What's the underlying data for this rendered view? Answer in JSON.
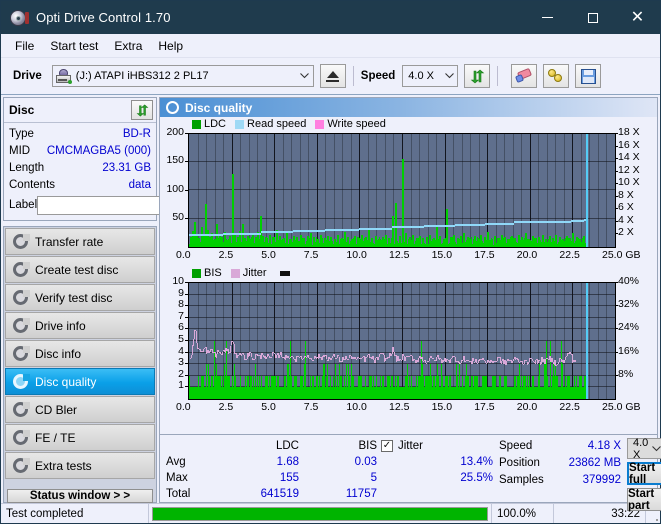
{
  "window": {
    "title": "Opti Drive Control 1.70",
    "icon": "disc-icon",
    "minimize_label": "–",
    "maximize_label": "□",
    "close_label": "✕"
  },
  "menu": {
    "items": [
      {
        "label": "File"
      },
      {
        "label": "Start test"
      },
      {
        "label": "Extra"
      },
      {
        "label": "Help"
      }
    ]
  },
  "toolbar": {
    "drive_label": "Drive",
    "drive_value": "(J:)  ATAPI iHBS312  2 PL17",
    "eject_icon": "eject-icon",
    "speed_label": "Speed",
    "speed_value": "4.0 X",
    "refresh_icon": "refresh-icon",
    "erase_icon": "eraser-icon",
    "bulb_icon": "bulbs-icon",
    "save_icon": "save-icon"
  },
  "disc_panel": {
    "title": "Disc",
    "refresh_icon": "refresh-icon",
    "rows": [
      {
        "key": "Type",
        "value": "BD-R"
      },
      {
        "key": "MID",
        "value": "CMCMAGBA5 (000)"
      },
      {
        "key": "Length",
        "value": "23.31 GB"
      },
      {
        "key": "Contents",
        "value": "data"
      }
    ],
    "label_key": "Label",
    "label_value": "",
    "label_placeholder": "",
    "disc_icon": "disc-icon"
  },
  "sidebar": {
    "items": [
      {
        "label": "Transfer rate",
        "icon": "disc-test-icon",
        "active": false
      },
      {
        "label": "Create test disc",
        "icon": "disc-test-icon",
        "active": false
      },
      {
        "label": "Verify test disc",
        "icon": "disc-test-icon",
        "active": false
      },
      {
        "label": "Drive info",
        "icon": "disc-test-icon",
        "active": false
      },
      {
        "label": "Disc info",
        "icon": "disc-test-icon",
        "active": false
      },
      {
        "label": "Disc quality",
        "icon": "disc-test-icon",
        "active": true
      },
      {
        "label": "CD Bler",
        "icon": "disc-test-icon",
        "active": false
      },
      {
        "label": "FE / TE",
        "icon": "disc-test-icon",
        "active": false
      },
      {
        "label": "Extra tests",
        "icon": "disc-test-icon",
        "active": false
      }
    ],
    "status_window_label": "Status window > >"
  },
  "panel": {
    "title": "Disc quality",
    "icon": "disc-quality-icon"
  },
  "stats": {
    "col_headers": [
      "LDC",
      "BIS"
    ],
    "rows": [
      {
        "key": "Avg",
        "ldc": "1.68",
        "bis": "0.03",
        "jitter": "13.4%"
      },
      {
        "key": "Max",
        "ldc": "155",
        "bis": "5",
        "jitter": "25.5%"
      },
      {
        "key": "Total",
        "ldc": "641519",
        "bis": "11757",
        "jitter": ""
      }
    ],
    "jitter_label": "Jitter",
    "jitter_checked": true,
    "speed_label": "Speed",
    "speed_value": "4.18 X",
    "position_label": "Position",
    "position_value": "23862 MB",
    "samples_label": "Samples",
    "samples_value": "379992",
    "speed_select": "4.0 X",
    "start_full_label": "Start full",
    "start_part_label": "Start part"
  },
  "statusbar": {
    "message": "Test completed",
    "progress_percent": "100.0%",
    "progress_value": 100,
    "elapsed": "33:22"
  },
  "colors": {
    "accent": "#0aa0e8",
    "ldc_green": "#00b000",
    "read_speed": "#7fd4f5",
    "write_speed": "#ff80e0",
    "jitter_pink": "#d9a8d8",
    "plot_bg": "#5f6f8d",
    "value_blue": "#0000d0",
    "titlebar": "#1f3b4d"
  },
  "chart_data": [
    {
      "type": "line",
      "id": "ldc-chart",
      "title": "LDC / Read speed",
      "legend": [
        {
          "name": "LDC",
          "color": "#00a000"
        },
        {
          "name": "Read speed",
          "color": "#7fd4f5"
        },
        {
          "name": "Write speed",
          "color": "#ff80e0"
        }
      ],
      "legend_position": "top-left",
      "xlabel": "GB",
      "xlim": [
        0,
        25
      ],
      "xticks": [
        "0.0",
        "2.5",
        "5.0",
        "7.5",
        "10.0",
        "12.5",
        "15.0",
        "17.5",
        "20.0",
        "22.5",
        "25.0"
      ],
      "ylabel": "LDC",
      "ylim": [
        0,
        200
      ],
      "yticks": [
        50,
        100,
        150,
        200
      ],
      "y2label": "X",
      "y2lim": [
        0,
        18
      ],
      "y2ticks": [
        "2 X",
        "4 X",
        "6 X",
        "8 X",
        "10 X",
        "12 X",
        "14 X",
        "16 X",
        "18 X"
      ],
      "grid": true,
      "data_end_gb": 23.31,
      "series": [
        {
          "name": "LDC",
          "type": "bar",
          "color": "#00d000",
          "x": [
            0.05,
            0.18,
            0.3,
            0.42,
            0.55,
            0.68,
            0.8,
            0.92,
            1.05,
            1.18,
            1.3,
            1.45,
            1.6,
            1.75,
            1.9,
            2.05,
            2.2,
            2.35,
            2.5,
            2.65,
            2.8,
            2.95,
            3.1,
            3.25,
            3.4,
            3.55,
            3.7,
            3.85,
            4.0,
            4.15,
            4.3,
            4.5,
            4.7,
            4.9,
            5.1,
            5.3,
            5.5,
            5.7,
            5.9,
            6.1,
            6.3,
            6.5,
            6.7,
            6.9,
            7.1,
            7.3,
            7.5,
            7.7,
            7.9,
            8.1,
            8.3,
            8.5,
            8.7,
            8.9,
            9.1,
            9.3,
            9.5,
            9.7,
            9.9,
            10.1,
            10.3,
            10.5,
            10.7,
            10.9,
            11.1,
            11.3,
            11.5,
            11.7,
            11.9,
            12.1,
            12.3,
            12.5,
            12.7,
            12.9,
            13.1,
            13.3,
            13.5,
            13.7,
            13.9,
            14.1,
            14.3,
            14.5,
            14.7,
            14.9,
            15.1,
            15.3,
            15.5,
            15.7,
            15.9,
            16.1,
            16.3,
            16.5,
            16.7,
            16.9,
            17.1,
            17.3,
            17.5,
            17.7,
            17.9,
            18.1,
            18.3,
            18.5,
            18.7,
            18.9,
            19.1,
            19.3,
            19.5,
            19.7,
            19.9,
            20.1,
            20.3,
            20.5,
            20.7,
            20.9,
            21.1,
            21.3,
            21.5,
            21.7,
            21.9,
            22.1,
            22.3,
            22.5,
            22.7,
            22.9,
            23.1,
            23.3
          ],
          "values": [
            18,
            28,
            45,
            22,
            16,
            35,
            20,
            76,
            30,
            18,
            24,
            14,
            40,
            22,
            18,
            26,
            12,
            20,
            130,
            22,
            18,
            28,
            40,
            16,
            20,
            14,
            22,
            18,
            26,
            55,
            20,
            16,
            22,
            18,
            30,
            20,
            16,
            24,
            14,
            20,
            18,
            22,
            16,
            20,
            24,
            18,
            14,
            22,
            16,
            20,
            18,
            14,
            22,
            16,
            26,
            18,
            14,
            20,
            16,
            22,
            18,
            30,
            16,
            20,
            14,
            18,
            22,
            16,
            55,
            78,
            20,
            155,
            24,
            18,
            22,
            16,
            20,
            14,
            18,
            22,
            16,
            38,
            20,
            14,
            68,
            18,
            22,
            16,
            20,
            24,
            18,
            14,
            20,
            16,
            22,
            18,
            26,
            14,
            20,
            16,
            22,
            18,
            14,
            20,
            16,
            22,
            18,
            24,
            14,
            20,
            16,
            18,
            22,
            14,
            20,
            16,
            22,
            18,
            14,
            20,
            16,
            24,
            18,
            14,
            20,
            16
          ]
        },
        {
          "name": "Read speed",
          "type": "step-line",
          "color": "#7fd4f5",
          "x": [
            0.0,
            2.0,
            4.2,
            6.1,
            8.0,
            10.0,
            11.9,
            13.8,
            15.6,
            17.4,
            19.1,
            20.8,
            22.4,
            23.2,
            23.3
          ],
          "values": [
            2.1,
            2.3,
            2.5,
            2.7,
            2.9,
            3.1,
            3.3,
            3.5,
            3.7,
            3.9,
            4.1,
            4.2,
            4.35,
            4.4,
            18.0
          ]
        }
      ]
    },
    {
      "type": "line",
      "id": "bis-chart",
      "title": "BIS / Jitter",
      "legend": [
        {
          "name": "BIS",
          "color": "#00a000"
        },
        {
          "name": "Jitter",
          "color": "#d9a8d8"
        }
      ],
      "legend_position": "top-left",
      "xlabel": "GB",
      "xlim": [
        0,
        25
      ],
      "xticks": [
        "0.0",
        "2.5",
        "5.0",
        "7.5",
        "10.0",
        "12.5",
        "15.0",
        "17.5",
        "20.0",
        "22.5",
        "25.0"
      ],
      "ylabel": "BIS",
      "ylim": [
        0,
        10
      ],
      "yticks": [
        1,
        2,
        3,
        4,
        5,
        6,
        7,
        8,
        9,
        10
      ],
      "y2label": "%",
      "y2lim": [
        0,
        40
      ],
      "y2ticks": [
        "8%",
        "16%",
        "24%",
        "32%",
        "40%"
      ],
      "grid": true,
      "data_end_gb": 23.31,
      "series": [
        {
          "name": "BIS",
          "type": "bar",
          "color": "#00d000",
          "note": "dense bars mostly at 1-2, occasional spikes to 3-5"
        },
        {
          "name": "Jitter",
          "type": "line",
          "color": "#d9a8d8",
          "x": [
            0.1,
            0.3,
            0.5,
            0.7,
            0.9,
            1.1,
            1.3,
            1.5,
            1.7,
            1.9,
            2.1,
            2.3,
            2.5,
            2.7,
            2.9,
            3.1,
            3.3,
            3.5,
            3.7,
            3.9,
            4.1,
            4.3,
            4.5,
            4.7,
            4.9,
            5.1,
            5.3,
            5.5,
            5.7,
            5.9,
            6.1,
            6.3,
            6.5,
            6.7,
            6.9,
            7.1,
            7.3,
            7.5,
            7.7,
            7.9,
            8.1,
            8.3,
            8.5,
            8.7,
            8.9,
            9.1,
            9.3,
            9.5,
            9.7,
            9.9,
            10.1,
            10.3,
            10.5,
            10.7,
            10.9,
            11.1,
            11.3,
            11.5,
            11.7,
            11.9,
            12.1,
            12.3,
            12.5,
            12.7,
            12.9,
            13.1,
            13.3,
            13.5,
            13.7,
            13.9,
            14.1,
            14.3,
            14.5,
            14.7,
            14.9,
            15.1,
            15.3,
            15.5,
            15.7,
            15.9,
            16.1,
            16.3,
            16.5,
            16.7,
            16.9,
            17.1,
            17.3,
            17.5,
            17.7,
            17.9,
            18.1,
            18.3,
            18.5,
            18.7,
            18.9,
            19.1,
            19.3,
            19.5,
            19.7,
            19.9,
            20.1,
            20.3,
            20.5,
            20.7,
            20.9,
            21.1,
            21.3,
            21.5,
            21.7,
            21.9,
            22.1,
            22.3,
            22.5,
            22.7,
            22.9,
            23.1,
            23.3
          ],
          "values": [
            3.6,
            6.1,
            4.3,
            4.0,
            4.4,
            3.9,
            4.2,
            3.8,
            4.1,
            3.9,
            4.3,
            4.0,
            5.0,
            3.7,
            4.0,
            3.8,
            3.6,
            3.9,
            3.5,
            3.8,
            3.6,
            3.9,
            3.7,
            3.5,
            3.8,
            3.6,
            3.9,
            3.7,
            3.5,
            3.8,
            3.6,
            3.4,
            3.7,
            3.5,
            3.8,
            3.6,
            3.4,
            3.7,
            3.5,
            3.8,
            3.6,
            3.4,
            3.7,
            3.5,
            3.3,
            3.6,
            3.4,
            3.7,
            3.5,
            3.3,
            3.6,
            3.4,
            3.7,
            3.5,
            3.3,
            3.6,
            3.8,
            3.4,
            3.6,
            4.3,
            3.5,
            3.3,
            3.6,
            3.4,
            3.7,
            3.5,
            3.3,
            3.6,
            3.4,
            3.2,
            3.5,
            3.3,
            3.6,
            3.4,
            3.2,
            3.5,
            3.3,
            3.6,
            3.4,
            3.2,
            3.5,
            3.3,
            3.1,
            3.4,
            3.2,
            3.5,
            3.3,
            3.1,
            3.4,
            3.2,
            3.5,
            3.3,
            3.1,
            3.4,
            3.2,
            3.5,
            3.3,
            3.1,
            3.4,
            3.2,
            3.5,
            3.3,
            3.1,
            3.4,
            3.2,
            3.5,
            3.3,
            3.1,
            3.4,
            3.2,
            3.5,
            4.2,
            3.3
          ]
        }
      ]
    }
  ]
}
